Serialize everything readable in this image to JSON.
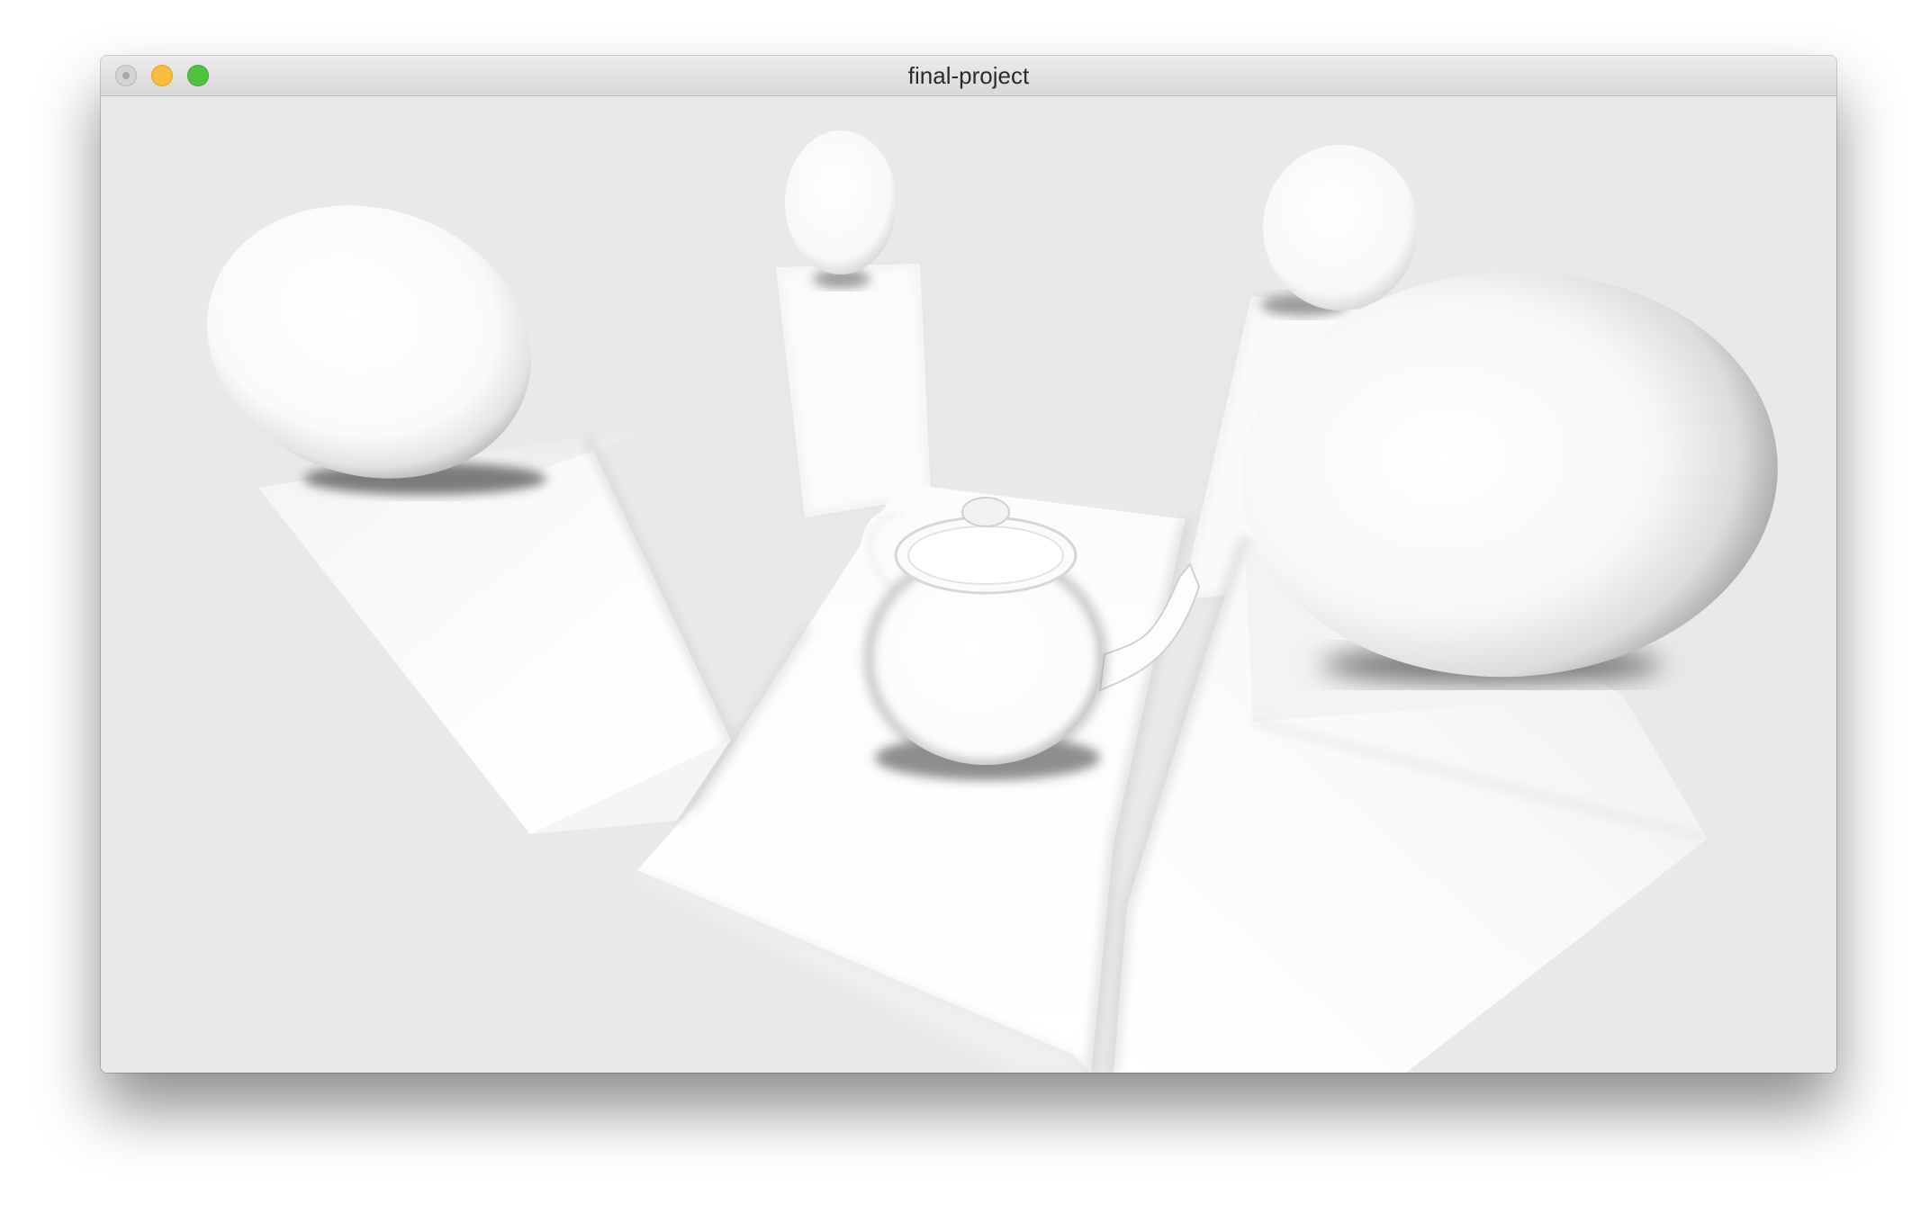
{
  "window": {
    "title": "final-project",
    "controls": {
      "close": "close-icon",
      "minimize": "minimize-icon",
      "maximize": "maximize-icon"
    },
    "colors": {
      "close": "#d4d3d4",
      "minimize": "#f6bd3b",
      "maximize": "#4fc241",
      "scene_background": "#e9e9e9",
      "object_surface": "#ffffff"
    }
  },
  "scene": {
    "objects": [
      "left-pedestal",
      "left-sphere",
      "back-left-pedestal",
      "back-left-sphere",
      "back-right-pedestal",
      "back-right-sphere",
      "center-table",
      "teapot",
      "right-pedestal",
      "right-sphere"
    ]
  }
}
